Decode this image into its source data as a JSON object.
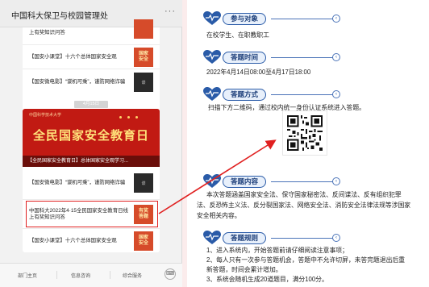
{
  "phone": {
    "title": "中国科大保卫与校园管理处",
    "more": "···",
    "top_items": [
      {
        "text": "上有奖知识问答",
        "thumb": "red",
        "thumb_label": ""
      },
      {
        "text": "【国安小课堂】十六个总体国家安全观",
        "thumb": "red",
        "thumb_label": "国家\n安全"
      },
      {
        "text": "【国安微电影】“谍机可乘”，谨防网络诈骗",
        "thumb": "dark",
        "thumb_label": "谍"
      }
    ],
    "timestamp": "4月15日",
    "banner": {
      "org": "中国科学技术大学",
      "title": "全民国家安全教育日",
      "caption": "【全民国家安全教育日】总体国家安全观学习..."
    },
    "bottom_items": [
      {
        "text": "【国安微电影】“谍机可乘”，谨防网络诈骗",
        "thumb": "dark",
        "thumb_label": "谍"
      },
      {
        "text": "中国科大2022年4·15全民国家安全教育日线上有奖知识问答",
        "thumb": "red",
        "thumb_label": "有奖\n答题"
      },
      {
        "text": "【国安小课堂】十六个总体国家安全观",
        "thumb": "red",
        "thumb_label": "国家\n安全"
      }
    ],
    "footer": [
      "部门主页",
      "信息咨询",
      "综合服务"
    ],
    "footer_icon": "keyboard-icon"
  },
  "sections": [
    {
      "title": "参与对象",
      "lines": [
        "在校学生、在职教职工"
      ]
    },
    {
      "title": "答题时间",
      "lines": [
        "2022年4月14日08:00至4月17日18:00"
      ]
    },
    {
      "title": "答题方式",
      "lines": [
        "扫描下方二维码，通过校内统一身份认证系统进入答题。"
      ]
    },
    {
      "title": "答题内容",
      "lines": [
        "本次答题涵盖国家安全法、保守国家秘密法、反间谍法、反有组织犯罪",
        "法、反恐怖主义法、反分裂国家法、网络安全法、消防安全法律法规等涉国家",
        "安全相关内容。"
      ]
    },
    {
      "title": "答题规则",
      "lines": [
        "1、进入系统内，开始答题前请仔细阅读注意事项；",
        "2、每人只有一次参与答题机会，答题中不允许切屏，未答完题退出后重",
        "新答题，时间会累计增加。",
        "3、系统会随机生成20道题目，满分100分。"
      ]
    }
  ],
  "colors": {
    "accent": "#2a5ba8",
    "highlight": "#e02020",
    "banner": "#c11a13"
  }
}
